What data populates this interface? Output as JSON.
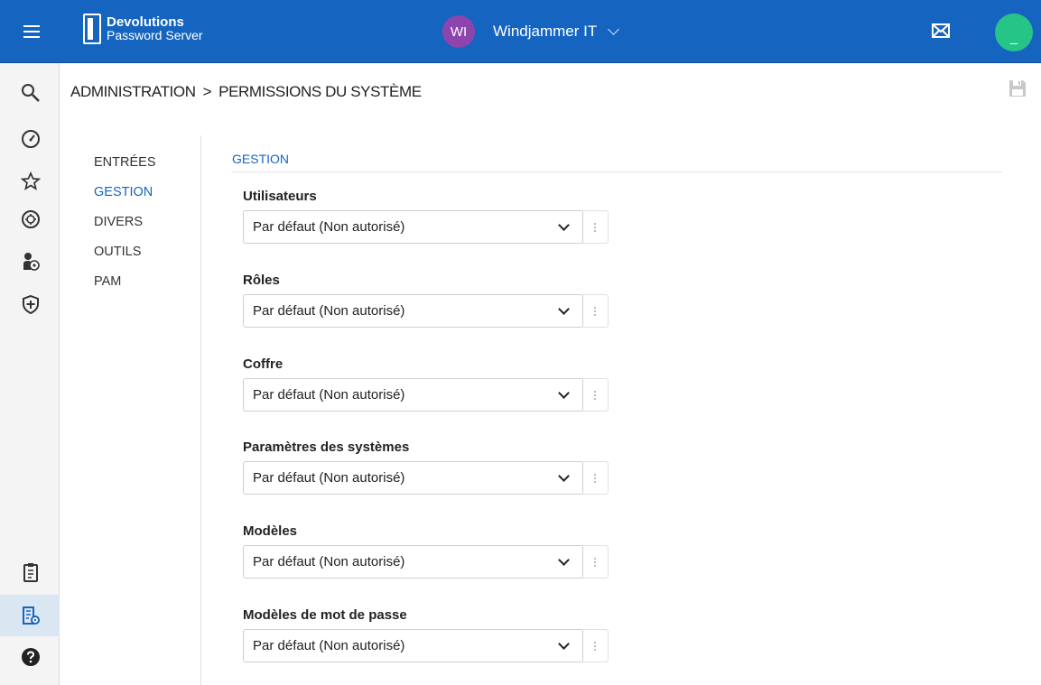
{
  "topbar": {
    "logo_line1": "Devolutions",
    "logo_line2": "Password Server",
    "org_initials": "WI",
    "org_name": "Windjammer IT",
    "user_initial": "_",
    "brand_color": "#1565c0"
  },
  "rail": {
    "icons": [
      "search-icon",
      "dashboard-icon",
      "favorites-icon",
      "vault-icon",
      "user-sessions-icon",
      "shield-icon",
      "clipboard-icon",
      "administration-icon",
      "help-icon"
    ]
  },
  "breadcrumb": {
    "root": "ADMINISTRATION",
    "separator": ">",
    "current": "PERMISSIONS DU SYSTÈME"
  },
  "subnav": {
    "items": [
      {
        "label": "ENTRÉES"
      },
      {
        "label": "GESTION"
      },
      {
        "label": "DIVERS"
      },
      {
        "label": "OUTILS"
      },
      {
        "label": "PAM"
      }
    ],
    "active_index": 1
  },
  "section": {
    "title": "GESTION",
    "fields": [
      {
        "label": "Utilisateurs",
        "value": "Par défaut (Non autorisé)"
      },
      {
        "label": "Rôles",
        "value": "Par défaut (Non autorisé)"
      },
      {
        "label": "Coffre",
        "value": "Par défaut (Non autorisé)"
      },
      {
        "label": "Paramètres des systèmes",
        "value": "Par défaut (Non autorisé)"
      },
      {
        "label": "Modèles",
        "value": "Par défaut (Non autorisé)"
      },
      {
        "label": "Modèles de mot de passe",
        "value": "Par défaut (Non autorisé)"
      }
    ]
  }
}
